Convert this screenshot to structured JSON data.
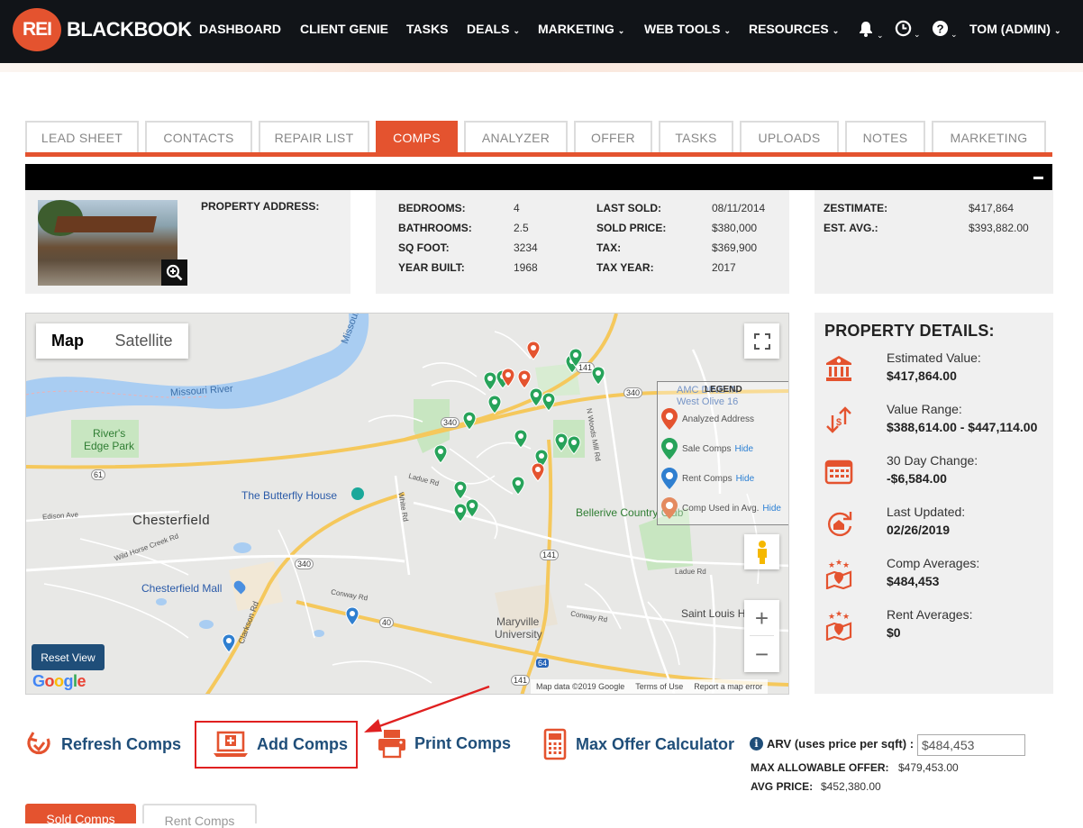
{
  "brand": {
    "logo_mark": "REI",
    "logo_text": "BLACKBOOK"
  },
  "nav": {
    "items": [
      "DASHBOARD",
      "CLIENT GENIE",
      "TASKS",
      "DEALS",
      "MARKETING",
      "WEB TOOLS",
      "RESOURCES"
    ],
    "user": "TOM (ADMIN)",
    "icons": [
      "bell-icon",
      "clock-icon",
      "help-icon"
    ]
  },
  "tabs": [
    "LEAD SHEET",
    "CONTACTS",
    "REPAIR LIST",
    "COMPS",
    "ANALYZER",
    "OFFER",
    "TASKS",
    "UPLOADS",
    "NOTES",
    "MARKETING"
  ],
  "active_tab": "COMPS",
  "property": {
    "address_label": "PROPERTY ADDRESS:",
    "bedrooms_label": "BEDROOMS:",
    "bedrooms": "4",
    "bathrooms_label": "BATHROOMS:",
    "bathrooms": "2.5",
    "sqft_label": "SQ FOOT:",
    "sqft": "3234",
    "year_built_label": "YEAR BUILT:",
    "year_built": "1968",
    "last_sold_label": "LAST SOLD:",
    "last_sold": "08/11/2014",
    "sold_price_label": "SOLD PRICE:",
    "sold_price": "$380,000",
    "tax_label": "TAX:",
    "tax": "$369,900",
    "tax_year_label": "TAX YEAR:",
    "tax_year": "2017",
    "zestimate_label": "ZESTIMATE:",
    "zestimate": "$417,864",
    "est_avg_label": "EST. AVG.:",
    "est_avg": "$393,882.00"
  },
  "map": {
    "map_button": "Map",
    "satellite_button": "Satellite",
    "reset_view": "Reset View",
    "google": "Google",
    "attribution": [
      "Map data ©2019 Google",
      "Terms of Use",
      "Report a map error"
    ],
    "labels": {
      "missouri_river": "Missouri River",
      "missouri_top": "Missouri",
      "rivers_edge_1": "River's",
      "rivers_edge_2": "Edge Park",
      "butterfly_house": "The Butterfly House",
      "chesterfield": "Chesterfield",
      "chesterfield_mall": "Chesterfield Mall",
      "bellerive": "Bellerive Country Club",
      "amc": "AMC DINE-IN",
      "west_olive": "West Olive 16",
      "maryville_1": "Maryville",
      "maryville_2": "University",
      "saint_louis": "Saint Louis H",
      "edison": "Edison Ave",
      "ladue_rd": "Ladue Rd",
      "conway_rd": "Conway Rd",
      "white_rd": "White Rd",
      "clarkson_rd": "Clarkson Rd",
      "n_woods_mill": "N Woods Mill Rd",
      "wild_horse": "Wild Horse Creek Rd",
      "r340": "340",
      "r141": "141",
      "r61": "61",
      "r40": "40",
      "r64": "64"
    },
    "legend": {
      "title": "LEGEND",
      "rows": [
        {
          "label": "Analyzed Address",
          "hide": "",
          "color": "#e4532f"
        },
        {
          "label": "Sale Comps",
          "hide": "Hide",
          "color": "#27a35a"
        },
        {
          "label": "Rent Comps",
          "hide": "Hide",
          "color": "#2f7fd0"
        },
        {
          "label": "Comp Used in Avg.",
          "hide": "Hide",
          "color": "#e48a5f"
        }
      ]
    }
  },
  "property_details": {
    "title": "PROPERTY DETAILS:",
    "items": [
      {
        "label": "Estimated Value:",
        "value": "$417,864.00",
        "icon": "bank-icon"
      },
      {
        "label": "Value Range:",
        "value": "$388,614.00 - $447,114.00",
        "icon": "value-range-icon"
      },
      {
        "label": "30 Day Change:",
        "value": "-$6,584.00",
        "icon": "calendar-icon"
      },
      {
        "label": "Last Updated:",
        "value": "02/26/2019",
        "icon": "refresh-icon"
      },
      {
        "label": "Comp Averages:",
        "value": "$484,453",
        "icon": "map-stars-icon"
      },
      {
        "label": "Rent Averages:",
        "value": "$0",
        "icon": "map-stars-icon"
      }
    ]
  },
  "actions": {
    "refresh": "Refresh Comps",
    "add": "Add Comps",
    "print": "Print Comps",
    "max_offer": "Max Offer Calculator"
  },
  "arv": {
    "label": "ARV (uses price per sqft) :",
    "value": "$484,453",
    "max_offer_label": "MAX ALLOWABLE OFFER:",
    "max_offer": "$479,453.00",
    "avg_price_label": "AVG PRICE:",
    "avg_price": "$452,380.00"
  },
  "bottom_tabs": {
    "sold": "Sold Comps",
    "rent": "Rent Comps"
  },
  "colors": {
    "accent": "#e4532f",
    "nav_bg": "#111418",
    "link_blue": "#1f4e79"
  }
}
